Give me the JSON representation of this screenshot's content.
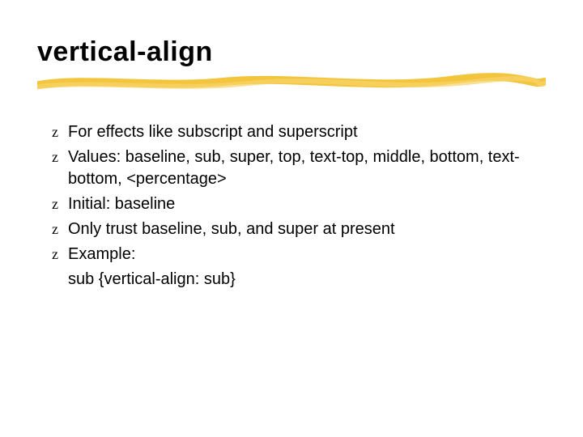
{
  "slide": {
    "title": "vertical-align",
    "bullets": [
      {
        "text": "For effects like subscript and superscript"
      },
      {
        "text": "Values: baseline, sub, super, top, text-top, middle, bottom, text-bottom, <percentage>"
      },
      {
        "text": "Initial: baseline"
      },
      {
        "text": "Only trust baseline, sub, and super at present"
      },
      {
        "text": "Example:",
        "subline": "sub {vertical-align: sub}"
      }
    ],
    "bullet_glyph": "z"
  }
}
